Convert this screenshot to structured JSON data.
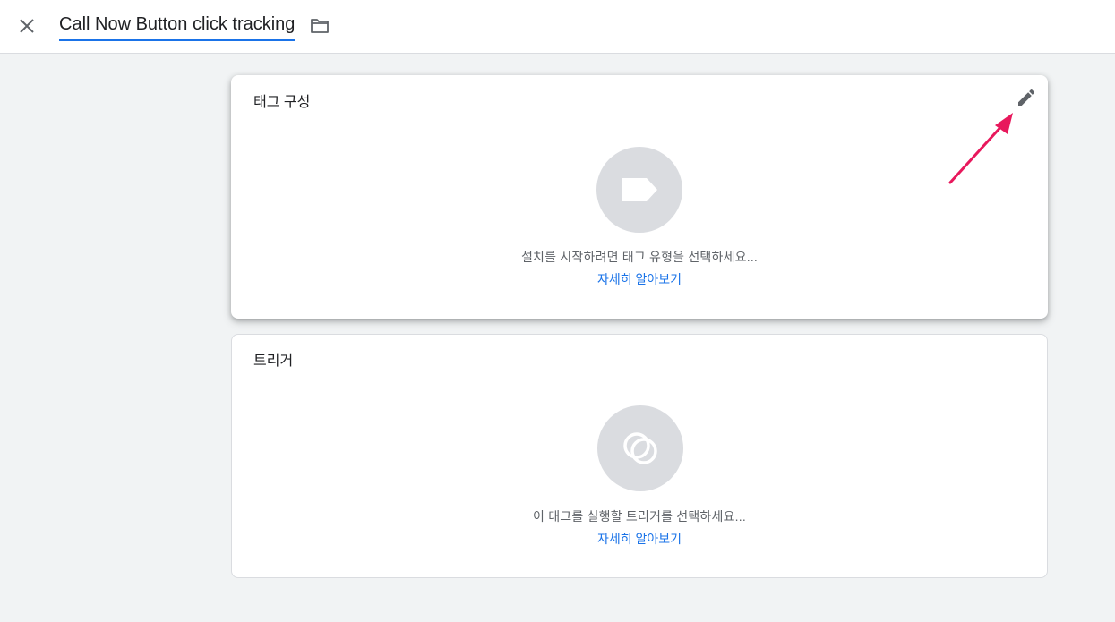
{
  "header": {
    "title": "Call Now Button click tracking",
    "close_icon": "close-icon",
    "folder_icon": "folder-icon"
  },
  "tag_config": {
    "title": "태그 구성",
    "hint": "설치를 시작하려면 태그 유형을 선택하세요...",
    "learn_more": "자세히 알아보기",
    "edit_icon": "pencil-icon",
    "placeholder_icon": "tag-icon"
  },
  "trigger": {
    "title": "트리거",
    "hint": "이 태그를 실행할 트리거를 선택하세요...",
    "learn_more": "자세히 알아보기",
    "placeholder_icon": "trigger-icon"
  },
  "colors": {
    "accent": "#1a73e8",
    "annotation_arrow": "#e8185c",
    "placeholder_circle": "#dadce0"
  }
}
